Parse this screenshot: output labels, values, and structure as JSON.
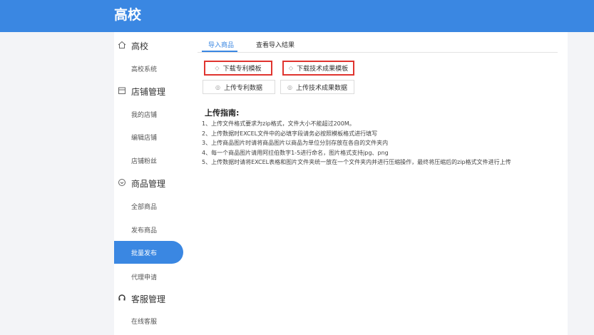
{
  "header": {
    "title": "高校"
  },
  "sidebar": {
    "groups": [
      {
        "label": "高校",
        "icon": "home-icon",
        "items": [
          {
            "label": "高校系统"
          }
        ]
      },
      {
        "label": "店铺管理",
        "icon": "store-icon",
        "items": [
          {
            "label": "我的店铺"
          },
          {
            "label": "编辑店铺"
          },
          {
            "label": "店铺粉丝"
          }
        ]
      },
      {
        "label": "商品管理",
        "icon": "goods-icon",
        "items": [
          {
            "label": "全部商品"
          },
          {
            "label": "发布商品"
          },
          {
            "label": "批量发布",
            "active": true
          },
          {
            "label": "代理申请"
          }
        ]
      },
      {
        "label": "客服管理",
        "icon": "headset-icon",
        "items": [
          {
            "label": "在线客服"
          }
        ]
      }
    ]
  },
  "main": {
    "tabs": [
      {
        "label": "导入商品",
        "active": true
      },
      {
        "label": "查看导入结果",
        "active": false
      }
    ],
    "buttons": {
      "download_patent": "下载专利模板",
      "download_tech": "下载技术成果模板",
      "upload_patent": "上传专利数据",
      "upload_tech": "上传技术成果数据"
    },
    "guide": {
      "title": "上传指南:",
      "lines": [
        "1、上传文件格式要求为zip格式，文件大小不能超过200M。",
        "2、上传数据时EXCEL文件中的必填字段请务必按照模板格式进行填写",
        "3、上传商品图片时请将商品图片以商品为单位分别存放在各自的文件夹内",
        "4、每一个商品图片请用阿拉伯数字1-5进行命名，图片格式支持jpg、png",
        "5、上传数据时请将EXCEL表格和图片文件夹统一放在一个文件夹内并进行压缩操作，最终将压缩后的zip格式文件进行上传"
      ]
    }
  },
  "colors": {
    "primary": "#3a87e2",
    "highlight_border": "#e0342f",
    "background": "#f3f4f7"
  }
}
